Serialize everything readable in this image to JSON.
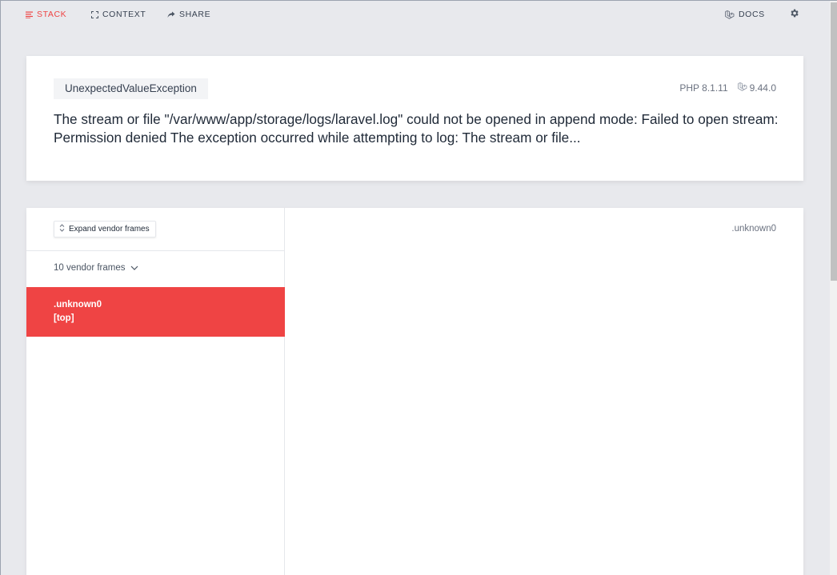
{
  "nav": {
    "stack": "STACK",
    "context": "CONTEXT",
    "share": "SHARE",
    "docs": "DOCS"
  },
  "header": {
    "exception_class": "UnexpectedValueException",
    "php_version": "PHP 8.1.11",
    "laravel_version": "9.44.0",
    "message": "The stream or file \"/var/www/app/storage/logs/laravel.log\" could not be opened in append mode: Failed to open stream: Permission denied The exception occurred while attempting to log: The stream or file..."
  },
  "stack": {
    "expand_button": "Expand vendor frames",
    "vendor_frames": "10 vendor frames",
    "active_frame": {
      "name": ".unknown0",
      "label": "[top]"
    },
    "detail_file": ".unknown0"
  },
  "colors": {
    "accent": "#ef4444",
    "background": "#e8e9ed",
    "card": "#ffffff"
  },
  "icons": {
    "stack": "list-icon",
    "context": "expand-icon",
    "share": "share-arrow-icon",
    "docs": "laravel-icon",
    "settings": "gear-icon"
  }
}
